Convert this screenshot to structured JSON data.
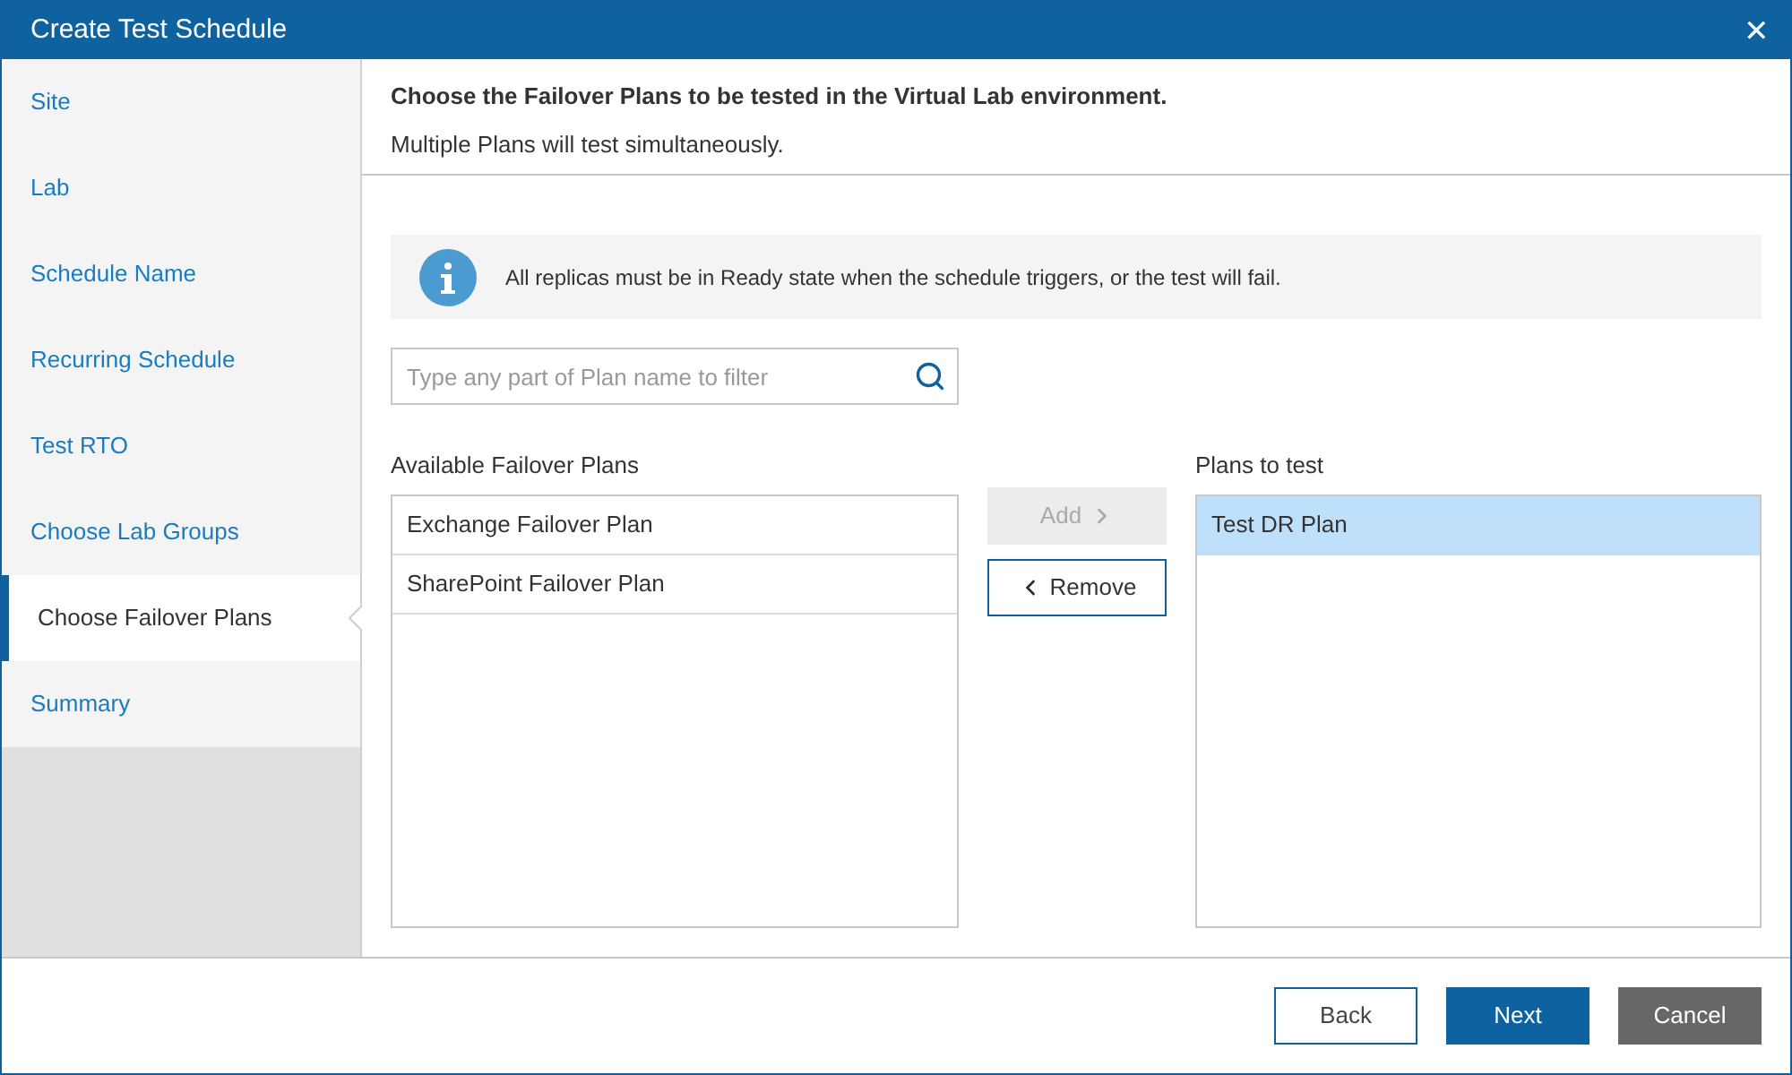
{
  "window": {
    "title": "Create Test Schedule",
    "close": "✕"
  },
  "sidebar": {
    "items": [
      {
        "label": "Site",
        "selected": false
      },
      {
        "label": "Lab",
        "selected": false
      },
      {
        "label": "Schedule Name",
        "selected": false
      },
      {
        "label": "Recurring Schedule",
        "selected": false
      },
      {
        "label": "Test RTO",
        "selected": false
      },
      {
        "label": "Choose Lab Groups",
        "selected": false
      },
      {
        "label": "Choose Failover Plans",
        "selected": true
      },
      {
        "label": "Summary",
        "selected": false
      }
    ]
  },
  "header": {
    "title": "Choose the Failover Plans to be tested in the Virtual Lab environment.",
    "subtitle": "Multiple Plans will test simultaneously."
  },
  "info": {
    "text": "All replicas must be in Ready state when the schedule triggers, or the test will fail."
  },
  "search": {
    "placeholder": "Type any part of Plan name to filter"
  },
  "available": {
    "label": "Available Failover Plans",
    "items": [
      {
        "label": "Exchange Failover Plan",
        "selected": false
      },
      {
        "label": "SharePoint Failover Plan",
        "selected": false
      }
    ]
  },
  "transfer_buttons": [
    {
      "label": "Add",
      "kind": "add",
      "disabled": true
    },
    {
      "label": "Remove",
      "kind": "remove",
      "disabled": false
    }
  ],
  "selected_plans": {
    "label": "Plans to test",
    "items": [
      {
        "label": "Test DR Plan",
        "selected": true
      }
    ]
  },
  "footer_buttons": [
    {
      "label": "Back",
      "kind": "secondary"
    },
    {
      "label": "Next",
      "kind": "primary"
    },
    {
      "label": "Cancel",
      "kind": "neutral"
    }
  ]
}
